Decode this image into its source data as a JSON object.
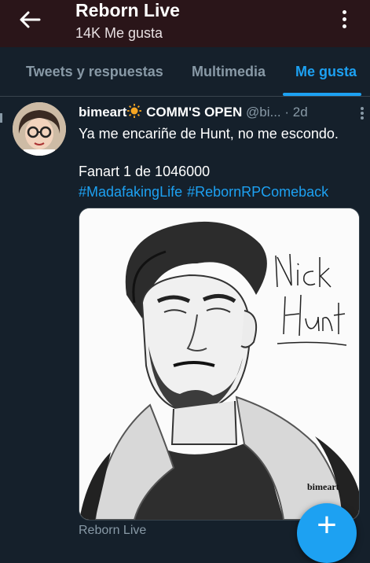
{
  "header": {
    "title": "Reborn Live",
    "subtitle": "14K Me gusta"
  },
  "tabs": [
    {
      "label": "Tweets y respuestas",
      "active": false
    },
    {
      "label": "Multimedia",
      "active": false
    },
    {
      "label": "Me gusta",
      "active": true
    }
  ],
  "tweet": {
    "name": "bimeart",
    "name_suffix": "COMM'S OPEN",
    "handle": "@bi...",
    "time": "· 2d",
    "text": "Ya me encariñe de Hunt, no me escondo.",
    "line2": "Fanart 1 de 1046000",
    "hashtags": [
      "#MadafakingLife",
      "#RebornRPComeback"
    ],
    "image_caption": "Nick Hunt",
    "image_signature": "bimeart"
  },
  "footer": {
    "text": "Reborn Live"
  },
  "colors": {
    "accent": "#1da1f2",
    "header_bg": "#2a1519",
    "page_bg": "#15202b"
  },
  "icons": {
    "back": "arrow-left-icon",
    "menu": "more-vertical-icon",
    "fab": "plus-icon",
    "sun": "sun-emoji-icon"
  }
}
